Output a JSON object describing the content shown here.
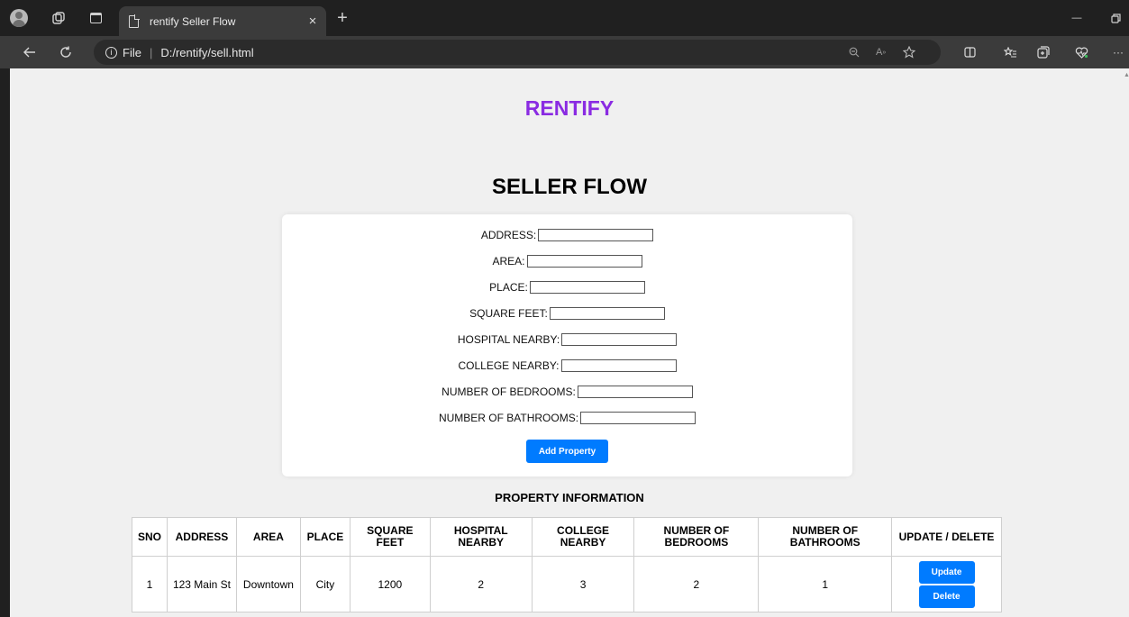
{
  "browser": {
    "tab_title": "rentify Seller Flow",
    "tab_close": "×",
    "new_tab": "+",
    "url_scheme": "File",
    "url_path": "D:/rentify/sell.html",
    "info_glyph": "i",
    "more_glyph": "···",
    "minimize_glyph": "—"
  },
  "page": {
    "brand": "RENTIFY",
    "heading": "SELLER FLOW",
    "accent_color": "#8a2be2",
    "button_color": "#007bff"
  },
  "form": {
    "fields": [
      {
        "label": "ADDRESS:",
        "value": ""
      },
      {
        "label": "AREA:",
        "value": ""
      },
      {
        "label": "PLACE:",
        "value": ""
      },
      {
        "label": "SQUARE FEET:",
        "value": ""
      },
      {
        "label": "HOSPITAL NEARBY:",
        "value": ""
      },
      {
        "label": "COLLEGE NEARBY:",
        "value": ""
      },
      {
        "label": "NUMBER OF BEDROOMS:",
        "value": ""
      },
      {
        "label": "NUMBER OF BATHROOMS:",
        "value": ""
      }
    ],
    "submit_label": "Add Property"
  },
  "table": {
    "title": "PROPERTY INFORMATION",
    "columns": [
      "SNO",
      "ADDRESS",
      "AREA",
      "PLACE",
      "SQUARE FEET",
      "HOSPITAL NEARBY",
      "COLLEGE NEARBY",
      "NUMBER OF BEDROOMS",
      "NUMBER OF BATHROOMS",
      "UPDATE / DELETE"
    ],
    "rows": [
      {
        "sno": "1",
        "address": "123 Main St",
        "area": "Downtown",
        "place": "City",
        "sqft": "1200",
        "hospital": "2",
        "college": "3",
        "bedrooms": "2",
        "bathrooms": "1",
        "update_label": "Update",
        "delete_label": "Delete"
      }
    ]
  },
  "icons": [
    "profile-avatar-icon",
    "workspaces-icon",
    "tab-actions-icon",
    "page-icon",
    "close-icon",
    "plus-icon",
    "back-arrow-icon",
    "refresh-icon",
    "info-icon",
    "zoom-icon",
    "read-aloud-icon",
    "favorite-star-icon",
    "split-screen-icon",
    "favorites-icon",
    "collections-icon",
    "health-icon",
    "more-icon",
    "minimize-icon",
    "restore-icon"
  ]
}
